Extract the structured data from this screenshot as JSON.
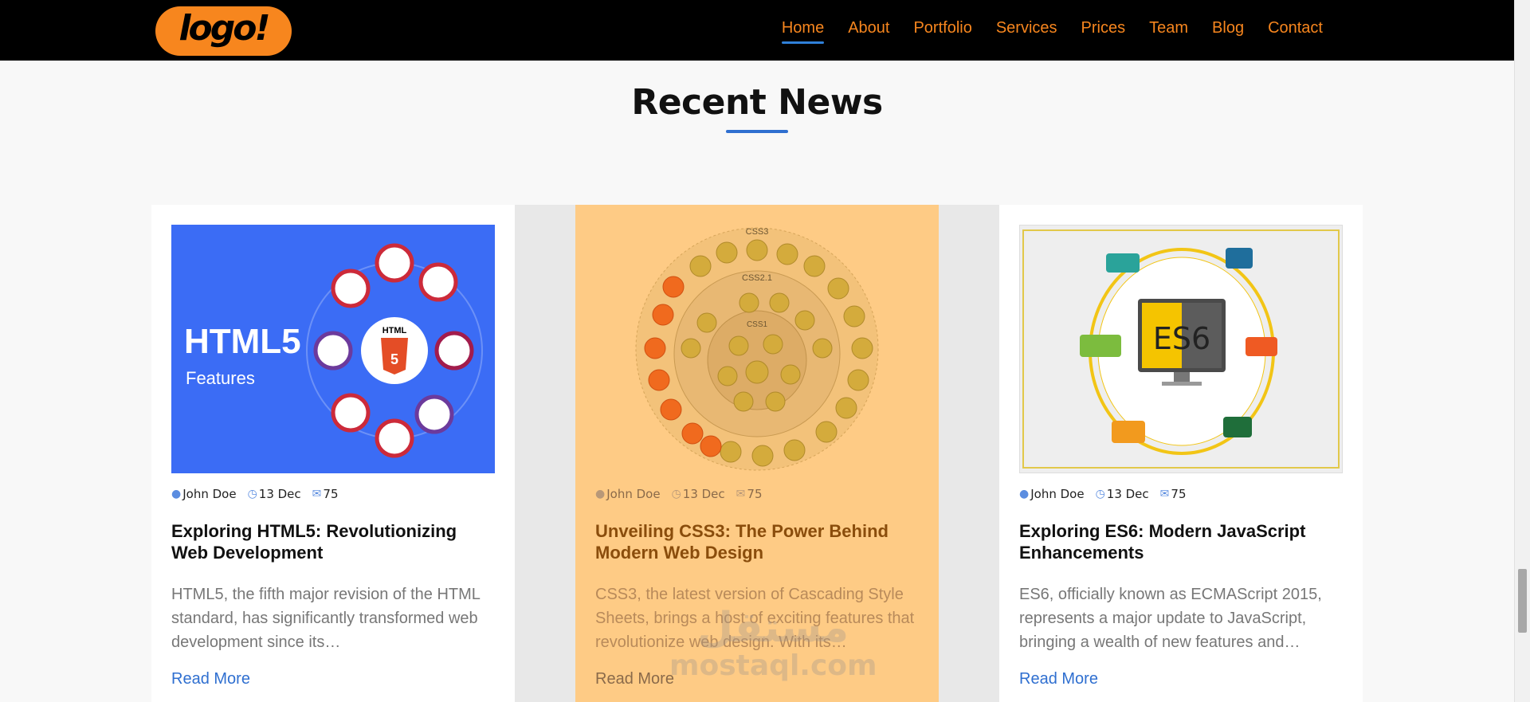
{
  "header": {
    "logo_text": "logo!",
    "nav": [
      "Home",
      "About",
      "Portfolio",
      "Services",
      "Prices",
      "Team",
      "Blog",
      "Contact"
    ],
    "active": "Home"
  },
  "section": {
    "title": "Recent News"
  },
  "cards": [
    {
      "image_text": {
        "big": "HTML5",
        "sub": "Features"
      },
      "author": "John Doe",
      "date": "13 Dec",
      "comments": "75",
      "title": "Exploring HTML5: Revolutionizing Web Development",
      "excerpt": "HTML5, the fifth major revision of the HTML standard, has significantly transformed web development since its…",
      "read_more": "Read More"
    },
    {
      "image_text": {
        "ring1": "CSS3",
        "ring2": "CSS2.1",
        "ring3": "CSS1"
      },
      "author": "John Doe",
      "date": "13 Dec",
      "comments": "75",
      "title": "Unveiling CSS3: The Power Behind Modern Web Design",
      "excerpt": "CSS3, the latest version of Cascading Style Sheets, brings a host of exciting features that revolutionize web design. With its…",
      "read_more": "Read More"
    },
    {
      "image_text": {
        "main": "ES6"
      },
      "author": "John Doe",
      "date": "13 Dec",
      "comments": "75",
      "title": "Exploring ES6: Modern JavaScript Enhancements",
      "excerpt": "ES6, officially known as ECMAScript 2015, represents a major update to JavaScript, bringing a wealth of new features and…",
      "read_more": "Read More"
    }
  ],
  "watermark": {
    "line1": "مستقل",
    "line2": "mostaql.com"
  },
  "colors": {
    "brand": "#f7861e",
    "accent": "#2f6fd0",
    "highlight_card": "#fecb85"
  },
  "icons": {
    "author": "user-icon",
    "date": "clock-icon",
    "comments": "comments-icon"
  }
}
